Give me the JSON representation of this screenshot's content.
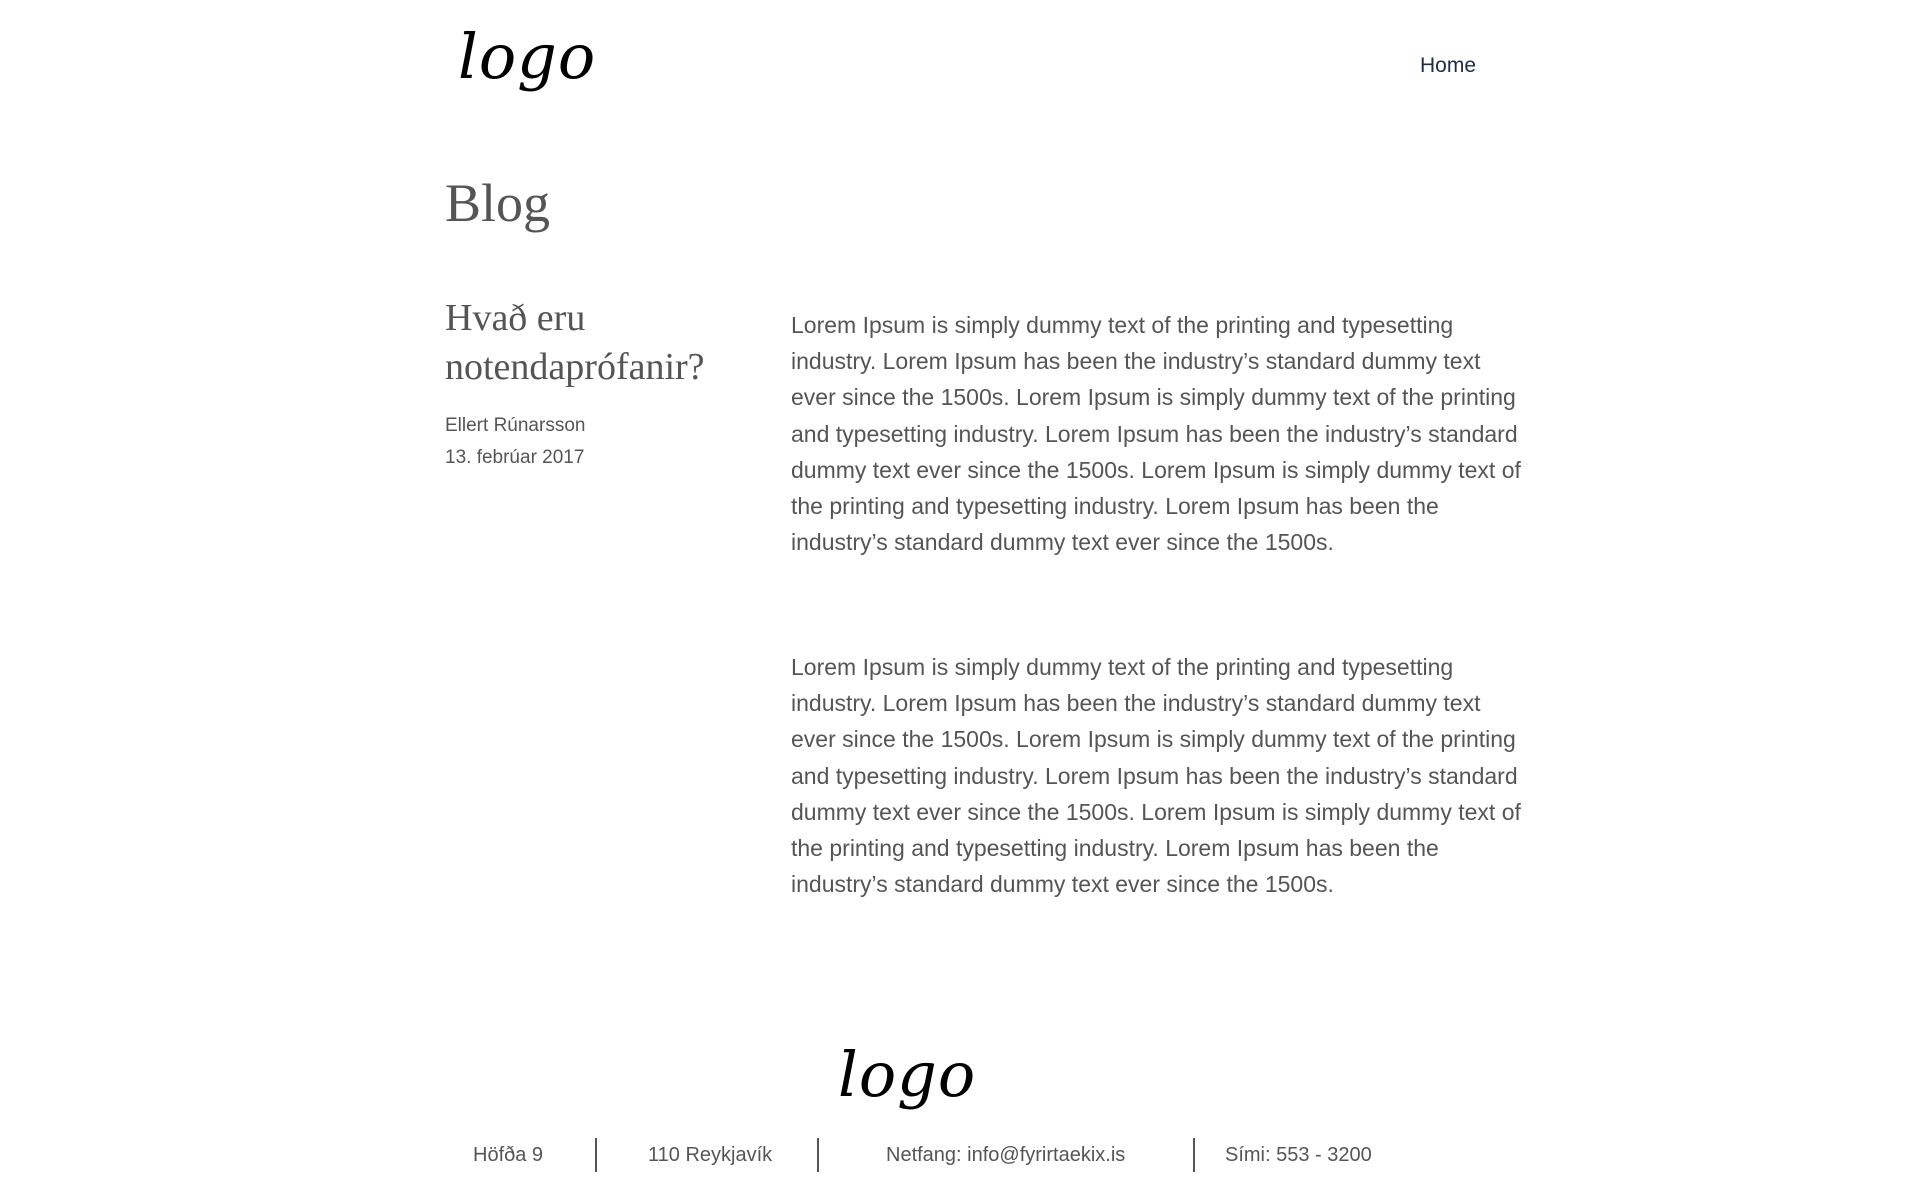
{
  "header": {
    "logo_text": "logo",
    "nav": {
      "home_label": "Home"
    }
  },
  "page": {
    "title": "Blog"
  },
  "post": {
    "title": "Hvað eru notendaprófanir?",
    "author": "Ellert Rúnarsson",
    "date": "13. febrúar 2017",
    "paragraphs": [
      "Lorem Ipsum is simply dummy text of the printing and typesetting industry. Lorem Ipsum has been the industry’s standard dummy text ever since the 1500s. Lorem Ipsum is simply dummy text of the printing and typesetting industry. Lorem Ipsum has been the industry’s standard dummy text ever since the 1500s. Lorem Ipsum is simply dummy text of the printing and typesetting industry. Lorem Ipsum has been the industry’s standard dummy text ever since the 1500s.",
      "Lorem Ipsum is simply dummy text of the printing and typesetting industry. Lorem Ipsum has been the industry’s standard dummy text ever since the 1500s. Lorem Ipsum is simply dummy text of the printing and typesetting industry. Lorem Ipsum has been the industry’s standard dummy text ever since the 1500s. Lorem Ipsum is simply dummy text of the printing and typesetting industry. Lorem Ipsum has been the industry’s standard dummy text ever since the 1500s."
    ]
  },
  "footer": {
    "logo_text": "logo",
    "address": "Höfða 9",
    "city": "110 Reykjavík",
    "email": "Netfang: info@fyrirtaekix.is",
    "phone": "Sími: 553 - 3200"
  }
}
